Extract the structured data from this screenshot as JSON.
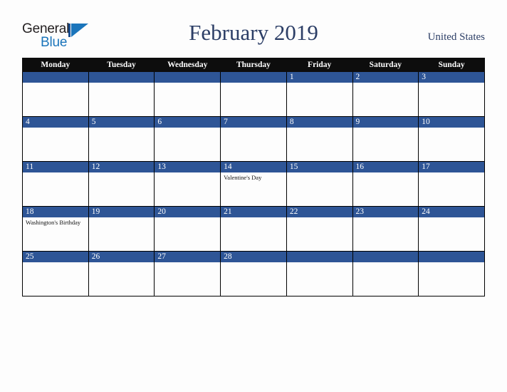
{
  "brand": {
    "name_part1": "General",
    "name_part2": "Blue",
    "mark": "triangle-logo-icon"
  },
  "header": {
    "title": "February 2019",
    "country": "United States"
  },
  "calendar": {
    "month": "February",
    "year": "2019",
    "weekday_headers": [
      "Monday",
      "Tuesday",
      "Wednesday",
      "Thursday",
      "Friday",
      "Saturday",
      "Sunday"
    ],
    "weeks": [
      [
        {
          "day": "",
          "events": []
        },
        {
          "day": "",
          "events": []
        },
        {
          "day": "",
          "events": []
        },
        {
          "day": "",
          "events": []
        },
        {
          "day": "1",
          "events": []
        },
        {
          "day": "2",
          "events": []
        },
        {
          "day": "3",
          "events": []
        }
      ],
      [
        {
          "day": "4",
          "events": []
        },
        {
          "day": "5",
          "events": []
        },
        {
          "day": "6",
          "events": []
        },
        {
          "day": "7",
          "events": []
        },
        {
          "day": "8",
          "events": []
        },
        {
          "day": "9",
          "events": []
        },
        {
          "day": "10",
          "events": []
        }
      ],
      [
        {
          "day": "11",
          "events": []
        },
        {
          "day": "12",
          "events": []
        },
        {
          "day": "13",
          "events": []
        },
        {
          "day": "14",
          "events": [
            "Valentine's Day"
          ]
        },
        {
          "day": "15",
          "events": []
        },
        {
          "day": "16",
          "events": []
        },
        {
          "day": "17",
          "events": []
        }
      ],
      [
        {
          "day": "18",
          "events": [
            "Washington's Birthday"
          ]
        },
        {
          "day": "19",
          "events": []
        },
        {
          "day": "20",
          "events": []
        },
        {
          "day": "21",
          "events": []
        },
        {
          "day": "22",
          "events": []
        },
        {
          "day": "23",
          "events": []
        },
        {
          "day": "24",
          "events": []
        }
      ],
      [
        {
          "day": "25",
          "events": []
        },
        {
          "day": "26",
          "events": []
        },
        {
          "day": "27",
          "events": []
        },
        {
          "day": "28",
          "events": []
        },
        {
          "day": "",
          "events": []
        },
        {
          "day": "",
          "events": []
        },
        {
          "day": "",
          "events": []
        }
      ]
    ]
  },
  "colors": {
    "accent_blue": "#2e5596",
    "header_black": "#0d0d0d",
    "title_navy": "#2c3e66",
    "logo_blue": "#1b75bb",
    "page_background": "#fdfdfd"
  }
}
